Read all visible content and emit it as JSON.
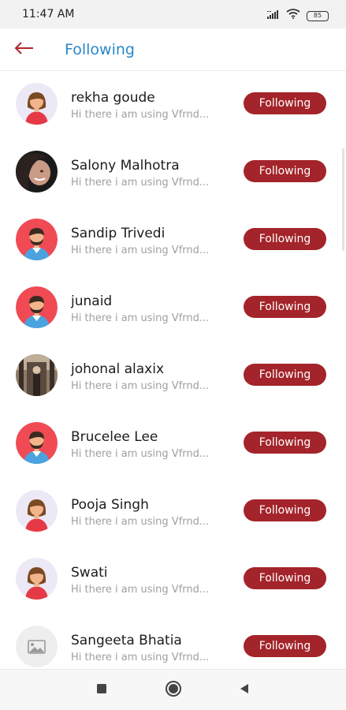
{
  "status_bar": {
    "time": "11:47 AM",
    "battery": "85"
  },
  "app_bar": {
    "title": "Following",
    "back_icon": "arrow-left-icon"
  },
  "colors": {
    "accent_red": "#a3242a",
    "title_blue": "#2a86c9",
    "avatar_red": "#f04a55",
    "avatar_lavender": "#ece8f6"
  },
  "users": [
    {
      "name": "rekha goude",
      "status": "Hi there i am using Vfrnd...",
      "button": "Following",
      "avatar": "female-avatar-icon"
    },
    {
      "name": "Salony Malhotra",
      "status": "Hi there i am using Vfrnd...",
      "button": "Following",
      "avatar": "profile-photo"
    },
    {
      "name": "Sandip Trivedi",
      "status": "Hi there i am using Vfrnd...",
      "button": "Following",
      "avatar": "male-avatar-icon"
    },
    {
      "name": "junaid",
      "status": "Hi there i am using Vfrnd...",
      "button": "Following",
      "avatar": "male-avatar-icon"
    },
    {
      "name": "johonal alaxix",
      "status": "Hi there i am using Vfrnd...",
      "button": "Following",
      "avatar": "profile-photo"
    },
    {
      "name": "Brucelee Lee",
      "status": "Hi there i am using Vfrnd...",
      "button": "Following",
      "avatar": "male-avatar-icon"
    },
    {
      "name": "Pooja Singh",
      "status": "Hi there i am using Vfrnd...",
      "button": "Following",
      "avatar": "female-avatar-icon"
    },
    {
      "name": "Swati",
      "status": "Hi there i am using Vfrnd...",
      "button": "Following",
      "avatar": "female-avatar-icon"
    },
    {
      "name": "Sangeeta Bhatia",
      "status": "Hi there i am using Vfrnd...",
      "button": "Following",
      "avatar": "image-placeholder-icon"
    }
  ],
  "nav_bar": {
    "items": [
      "square-recents-icon",
      "circle-home-icon",
      "triangle-back-icon"
    ]
  }
}
